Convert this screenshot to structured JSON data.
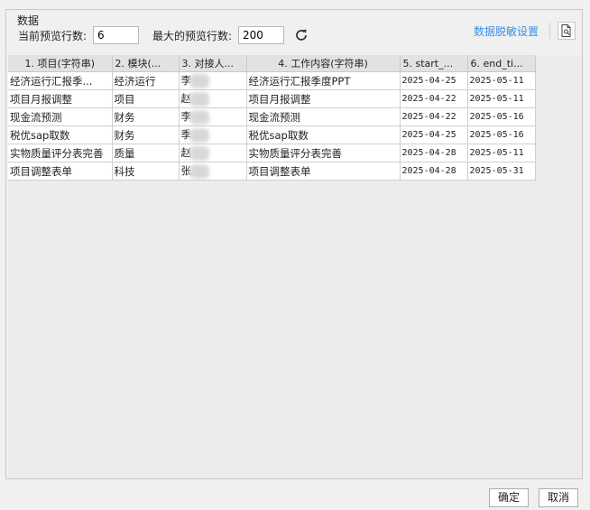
{
  "group_title": "数据",
  "preview": {
    "current_label": "当前预览行数:",
    "current_value": "6",
    "max_label": "最大的预览行数:",
    "max_value": "200"
  },
  "desensitize_link": "数据脱敏设置",
  "icons": {
    "refresh": "refresh-icon",
    "preview_doc": "document-search-icon"
  },
  "table": {
    "columns": [
      "1. 项目(字符串)",
      "2. 模块(...",
      "3. 对接人...",
      "4. 工作内容(字符串)",
      "5. start_...",
      "6. end_ti..."
    ],
    "rows": [
      [
        "经济运行汇报季...",
        "经济运行",
        "李",
        "经济运行汇报季度PPT",
        "2025-04-25",
        "2025-05-11"
      ],
      [
        "项目月报调整",
        "项目",
        "赵",
        "项目月报调整",
        "2025-04-22",
        "2025-05-11"
      ],
      [
        "现金流预测",
        "财务",
        "李",
        "现金流预测",
        "2025-04-22",
        "2025-05-16"
      ],
      [
        "税优sap取数",
        "财务",
        "季",
        "税优sap取数",
        "2025-04-25",
        "2025-05-16"
      ],
      [
        "实物质量评分表完善",
        "质量",
        "赵",
        "实物质量评分表完善",
        "2025-04-28",
        "2025-05-11"
      ],
      [
        "项目调整表单",
        "科技",
        "张",
        "项目调整表单",
        "2025-04-28",
        "2025-05-31"
      ]
    ]
  },
  "buttons": {
    "ok": "确定",
    "cancel": "取消"
  }
}
